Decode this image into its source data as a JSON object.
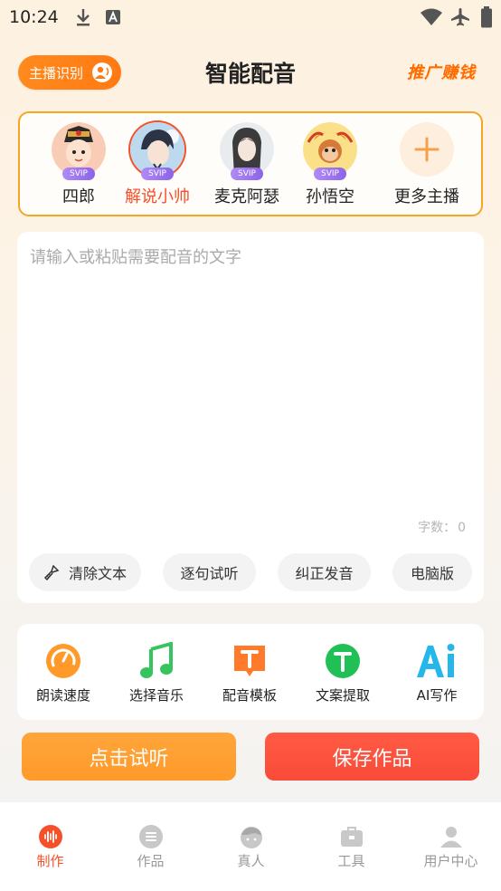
{
  "status_bar": {
    "time": "10:24"
  },
  "header": {
    "anchor_button": "主播识别",
    "title": "智能配音",
    "promo": "推广赚钱"
  },
  "voices": [
    {
      "name": "四郎",
      "badge": "SVIP",
      "selected": false
    },
    {
      "name": "解说小帅",
      "badge": "SVIP",
      "selected": true
    },
    {
      "name": "麦克阿瑟",
      "badge": "SVIP",
      "selected": false
    },
    {
      "name": "孙悟空",
      "badge": "SVIP",
      "selected": false
    },
    {
      "name": "更多主播",
      "badge": "",
      "selected": false
    }
  ],
  "editor": {
    "placeholder": "请输入或粘贴需要配音的文字",
    "value": "",
    "count_label": "字数：",
    "count_value": "0"
  },
  "actions": [
    "清除文本",
    "逐句试听",
    "纠正发音",
    "电脑版"
  ],
  "tools": [
    "朗读速度",
    "选择音乐",
    "配音模板",
    "文案提取",
    "AI写作"
  ],
  "buttons": {
    "listen": "点击试听",
    "save": "保存作品"
  },
  "tabs": [
    "制作",
    "作品",
    "真人",
    "工具",
    "用户中心"
  ],
  "active_tab": "制作",
  "colors": {
    "accent_orange": "#ff9a2a",
    "accent_red": "#f94b39",
    "active_tab": "#f5502a",
    "panel_border": "#f5a623",
    "svip": "#8c63e8"
  }
}
